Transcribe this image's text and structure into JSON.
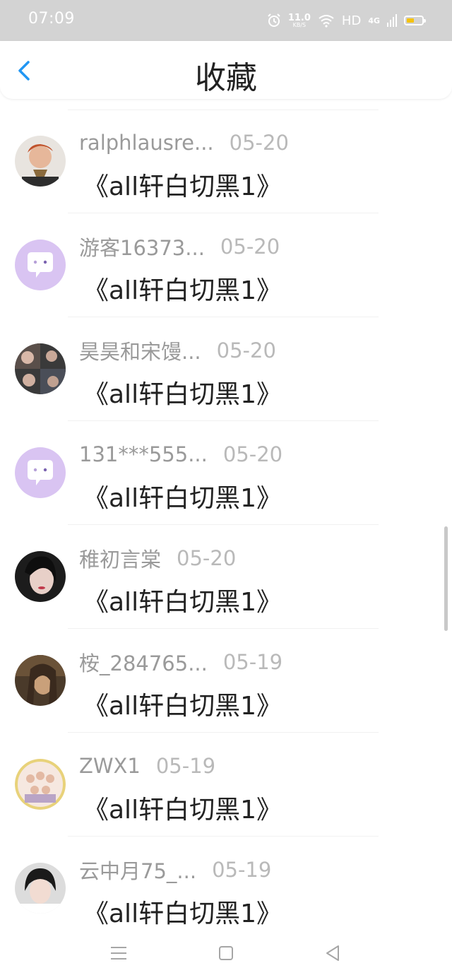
{
  "status_bar": {
    "time": "07:09",
    "speed_value": "11.0",
    "speed_unit": "KB/S",
    "hd": "HD",
    "network": "4G"
  },
  "header": {
    "title": "收藏",
    "back_icon": "chevron-left-icon",
    "accent_color": "#2196f3"
  },
  "favorites": [
    {
      "user": "ralphlausre...",
      "date": "05-20",
      "title": "《all轩白切黑1》",
      "avatar": "photo"
    },
    {
      "user": "游客16373...",
      "date": "05-20",
      "title": "《all轩白切黑1》",
      "avatar": "default"
    },
    {
      "user": "昊昊和宋馒...",
      "date": "05-20",
      "title": "《all轩白切黑1》",
      "avatar": "photo"
    },
    {
      "user": "131***555...",
      "date": "05-20",
      "title": "《all轩白切黑1》",
      "avatar": "default"
    },
    {
      "user": "稚初言棠",
      "date": "05-20",
      "title": "《all轩白切黑1》",
      "avatar": "photo"
    },
    {
      "user": "桉_284765...",
      "date": "05-19",
      "title": "《all轩白切黑1》",
      "avatar": "photo"
    },
    {
      "user": "ZWX1",
      "date": "05-19",
      "title": "《all轩白切黑1》",
      "avatar": "photo"
    },
    {
      "user": "云中月75_...",
      "date": "05-19",
      "title": "《all轩白切黑1》",
      "avatar": "photo"
    }
  ],
  "system_nav": {
    "menu_icon": "menu-icon",
    "home_icon": "home-square-icon",
    "back_icon": "back-triangle-icon"
  }
}
